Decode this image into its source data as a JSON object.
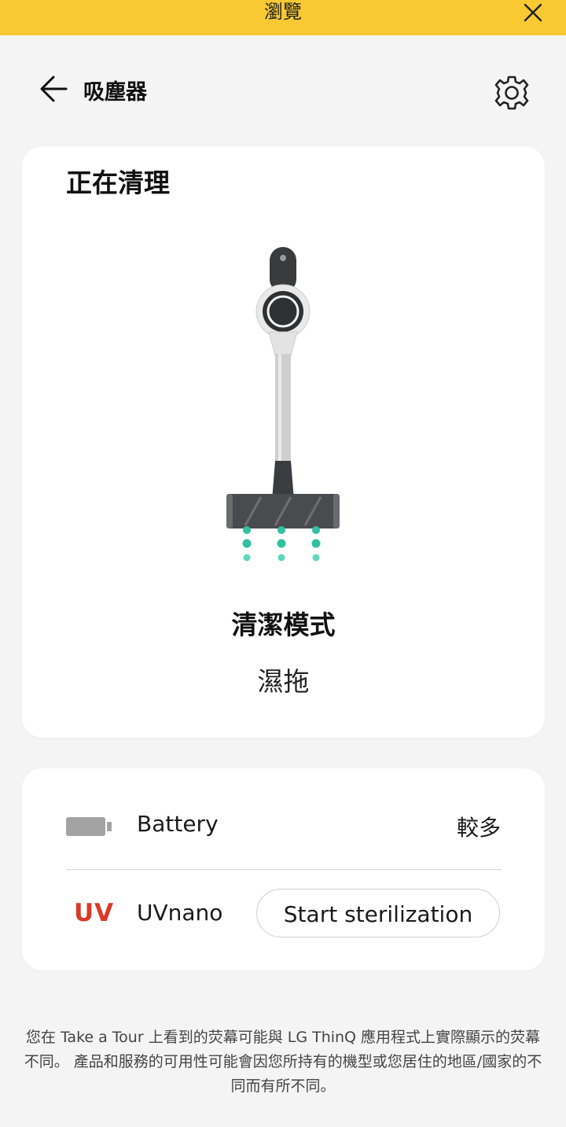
{
  "topbar": {
    "title": "瀏覽",
    "close_icon": "close-icon",
    "color": "#f9c933"
  },
  "header": {
    "title": "吸塵器",
    "back_icon": "arrow-left-icon",
    "settings_icon": "gear-icon"
  },
  "status_card": {
    "title": "正在清理",
    "mode_label": "清潔模式",
    "mode_value": "濕拖",
    "illustration": "stick-vacuum-wet-mop"
  },
  "info_card": {
    "battery": {
      "icon": "battery-icon",
      "label": "Battery",
      "value": "較多"
    },
    "uv": {
      "icon_text": "UV",
      "label": "UVnano",
      "button_label": "Start sterilization",
      "accent": "#d93a25"
    }
  },
  "footer": {
    "note": "您在 Take a Tour 上看到的荧幕可能與 LG ThinQ 應用程式上實際顯示的荧幕不同。 產品和服務的可用性可能會因您所持有的機型或您居住的地區/國家的不同而有所不同。"
  }
}
